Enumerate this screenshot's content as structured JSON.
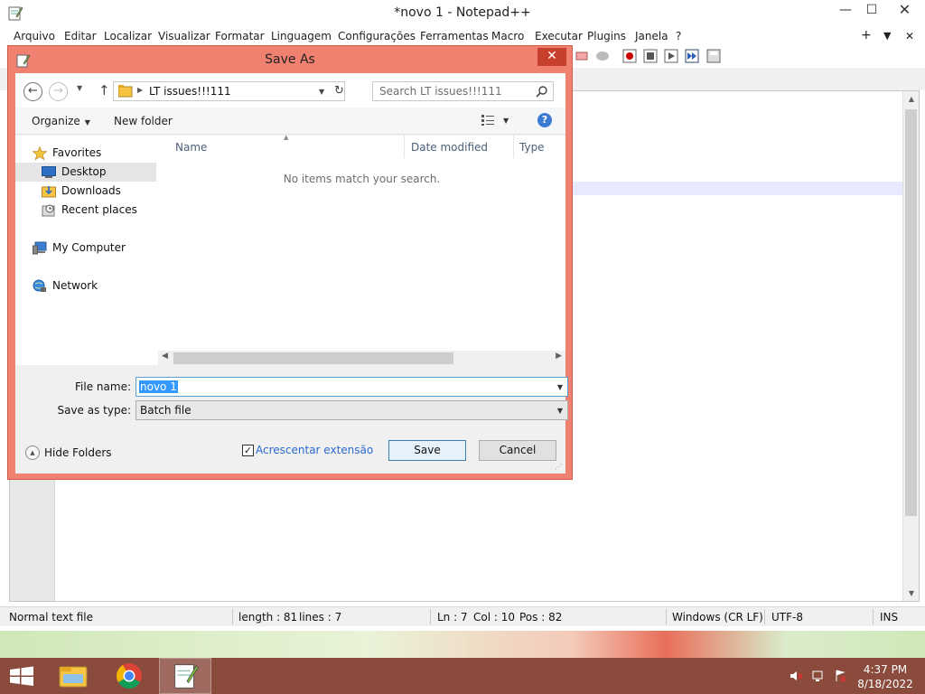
{
  "app": {
    "title": "*novo 1 - Notepad++",
    "menu": [
      "Arquivo",
      "Editar",
      "Localizar",
      "Visualizar",
      "Formatar",
      "Linguagem",
      "Configurações",
      "Ferramentas",
      "Macro",
      "Executar",
      "Plugins",
      "Janela",
      "?"
    ],
    "menu_right": [
      "+",
      "▼",
      "✕"
    ],
    "window_controls": {
      "minimize": "—",
      "maximize": "☐",
      "close": "✕"
    }
  },
  "status_bar": {
    "file_type": "Normal text file",
    "length": "length : 81",
    "lines": "lines : 7",
    "ln": "Ln : 7",
    "col": "Col : 10",
    "pos": "Pos : 82",
    "eol": "Windows (CR LF)",
    "encoding": "UTF-8",
    "mode": "INS"
  },
  "dialog": {
    "title": "Save As",
    "close_label": "✕",
    "address_path": "LT issues!!!111",
    "search_placeholder": "Search LT issues!!!111",
    "organize_label": "Organize",
    "new_folder_label": "New folder",
    "help_label": "?",
    "nav_items": [
      {
        "label": "Favorites",
        "icon": "star-icon"
      },
      {
        "label": "Desktop",
        "icon": "desktop-icon",
        "selected": true
      },
      {
        "label": "Downloads",
        "icon": "downloads-icon"
      },
      {
        "label": "Recent places",
        "icon": "recent-places-icon"
      },
      {
        "label": "My Computer",
        "icon": "computer-icon"
      },
      {
        "label": "Network",
        "icon": "network-icon"
      }
    ],
    "columns": [
      "Name",
      "Date modified",
      "Type"
    ],
    "empty_message": "No items match your search.",
    "file_name_label": "File name:",
    "file_name_value": "novo 1",
    "save_as_type_label": "Save as type:",
    "save_as_type_value": "Batch file",
    "hide_folders_label": "Hide Folders",
    "append_extension_label": "Acrescentar extensão",
    "append_extension_checked": true,
    "save_label": "Save",
    "cancel_label": "Cancel"
  },
  "taskbar": {
    "time": "4:37 PM",
    "date": "8/18/2022",
    "apps": [
      "file-explorer-icon",
      "chrome-icon",
      "notepad-plus-plus-icon"
    ]
  },
  "colors": {
    "dialog_frame": "#f08070",
    "taskbar": "#8a4a3c",
    "close_button": "#c7402e",
    "selection": "#3399ff"
  }
}
